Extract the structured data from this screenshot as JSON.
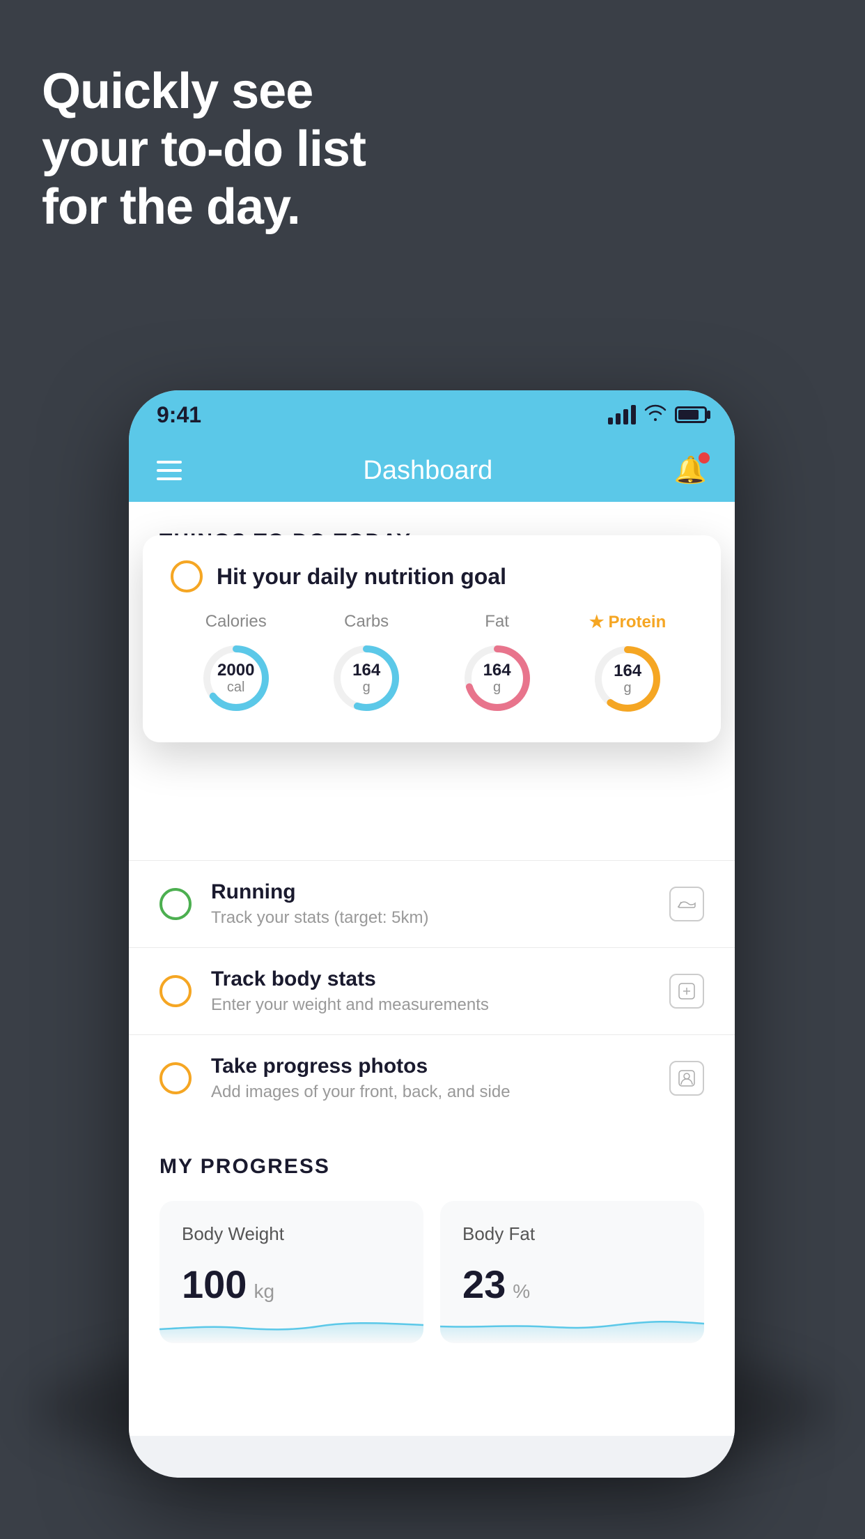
{
  "hero": {
    "line1": "Quickly see",
    "line2": "your to-do list",
    "line3": "for the day."
  },
  "status_bar": {
    "time": "9:41"
  },
  "header": {
    "title": "Dashboard"
  },
  "section_today": {
    "heading": "THINGS TO DO TODAY"
  },
  "nutrition_card": {
    "title": "Hit your daily nutrition goal",
    "items": [
      {
        "label": "Calories",
        "value": "2000",
        "unit": "cal",
        "color": "blue",
        "pct": 65
      },
      {
        "label": "Carbs",
        "value": "164",
        "unit": "g",
        "color": "blue",
        "pct": 55
      },
      {
        "label": "Fat",
        "value": "164",
        "unit": "g",
        "color": "pink",
        "pct": 70
      },
      {
        "label": "Protein",
        "value": "164",
        "unit": "g",
        "color": "yellow",
        "pct": 60,
        "star": true
      }
    ]
  },
  "todo_items": [
    {
      "title": "Running",
      "subtitle": "Track your stats (target: 5km)",
      "circle_color": "green",
      "icon": "shoe"
    },
    {
      "title": "Track body stats",
      "subtitle": "Enter your weight and measurements",
      "circle_color": "yellow",
      "icon": "scale"
    },
    {
      "title": "Take progress photos",
      "subtitle": "Add images of your front, back, and side",
      "circle_color": "yellow",
      "icon": "person"
    }
  ],
  "progress": {
    "heading": "MY PROGRESS",
    "cards": [
      {
        "title": "Body Weight",
        "value": "100",
        "unit": "kg"
      },
      {
        "title": "Body Fat",
        "value": "23",
        "unit": "%"
      }
    ]
  }
}
